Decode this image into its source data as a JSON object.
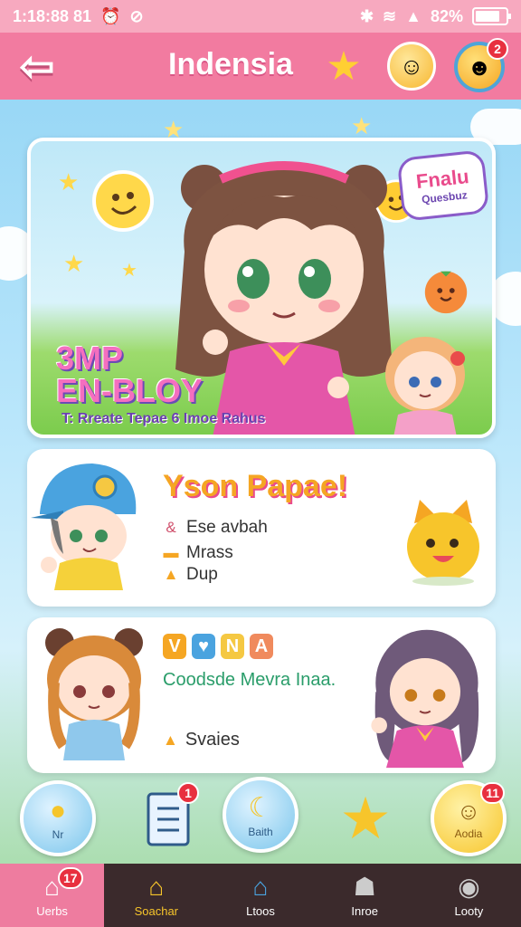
{
  "status_bar": {
    "time": "1:18:88 81",
    "battery": "82%"
  },
  "header": {
    "title": "Indensia",
    "avatar_badge": "2"
  },
  "hero": {
    "title_line1": "3MP",
    "title_line2": "EN-BLOY",
    "subtitle": "T: Rreate Tepae 6 Imoe Rahus",
    "sticker_line1": "Fnalu",
    "sticker_line2": "Quesbuz"
  },
  "card1": {
    "title": "Yson Papae!",
    "line1": "Ese avbah",
    "line2": "Mrass",
    "line3": "Dup"
  },
  "card2": {
    "tiles": [
      "V",
      "♥",
      "N",
      "A"
    ],
    "subtitle": "Coodsde Mevra  Inaa.",
    "line": "Svaies"
  },
  "quick_row": {
    "btn1_label": "Nr",
    "btn2_badge": "1",
    "btn3_label": "Baith",
    "btn5_badge": "11",
    "btn5_label": "Aodia"
  },
  "bottom_nav": {
    "items": [
      {
        "label": "Uerbs",
        "icon": "home-icon",
        "badge": "17"
      },
      {
        "label": "Soachar",
        "icon": "house-icon"
      },
      {
        "label": "Ltoos",
        "icon": "shop-icon"
      },
      {
        "label": "Inroe",
        "icon": "person-icon"
      },
      {
        "label": "Looty",
        "icon": "globe-icon"
      }
    ]
  },
  "colors": {
    "header": "#f27ba0",
    "nav_bg": "#3b2a2c",
    "nav_active": "#ee7c9f",
    "card_title": "#f5a623"
  }
}
